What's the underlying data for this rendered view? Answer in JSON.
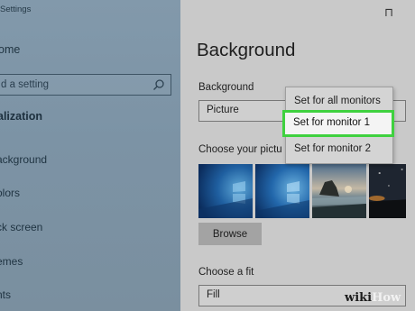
{
  "window": {
    "title": "Settings",
    "top_right_glyph": "⊓"
  },
  "sidebar": {
    "home_label": "ome",
    "search_placeholder": "d a setting",
    "category": "alization",
    "items": [
      {
        "label": "ackground"
      },
      {
        "label": "olors"
      },
      {
        "label": "ck screen"
      },
      {
        "label": "emes"
      },
      {
        "label": "nts"
      }
    ]
  },
  "main": {
    "title": "Background",
    "background_label": "Background",
    "background_value": "Picture",
    "choose_picture_label": "Choose your pictu",
    "browse_label": "Browse",
    "fit_label": "Choose a fit",
    "fit_value": "Fill",
    "thumbnails": [
      {
        "name": "windows-blue-1"
      },
      {
        "name": "windows-blue-2"
      },
      {
        "name": "beach-rock"
      },
      {
        "name": "night-sky"
      }
    ]
  },
  "context_menu": {
    "items": [
      {
        "label": "Set for all monitors"
      },
      {
        "label": "Set for monitor 1",
        "highlighted": true
      },
      {
        "label": "Set for monitor 2"
      }
    ],
    "highlight_color": "#3fd13f"
  },
  "watermark": {
    "part1": "wiki",
    "part2": "How"
  }
}
